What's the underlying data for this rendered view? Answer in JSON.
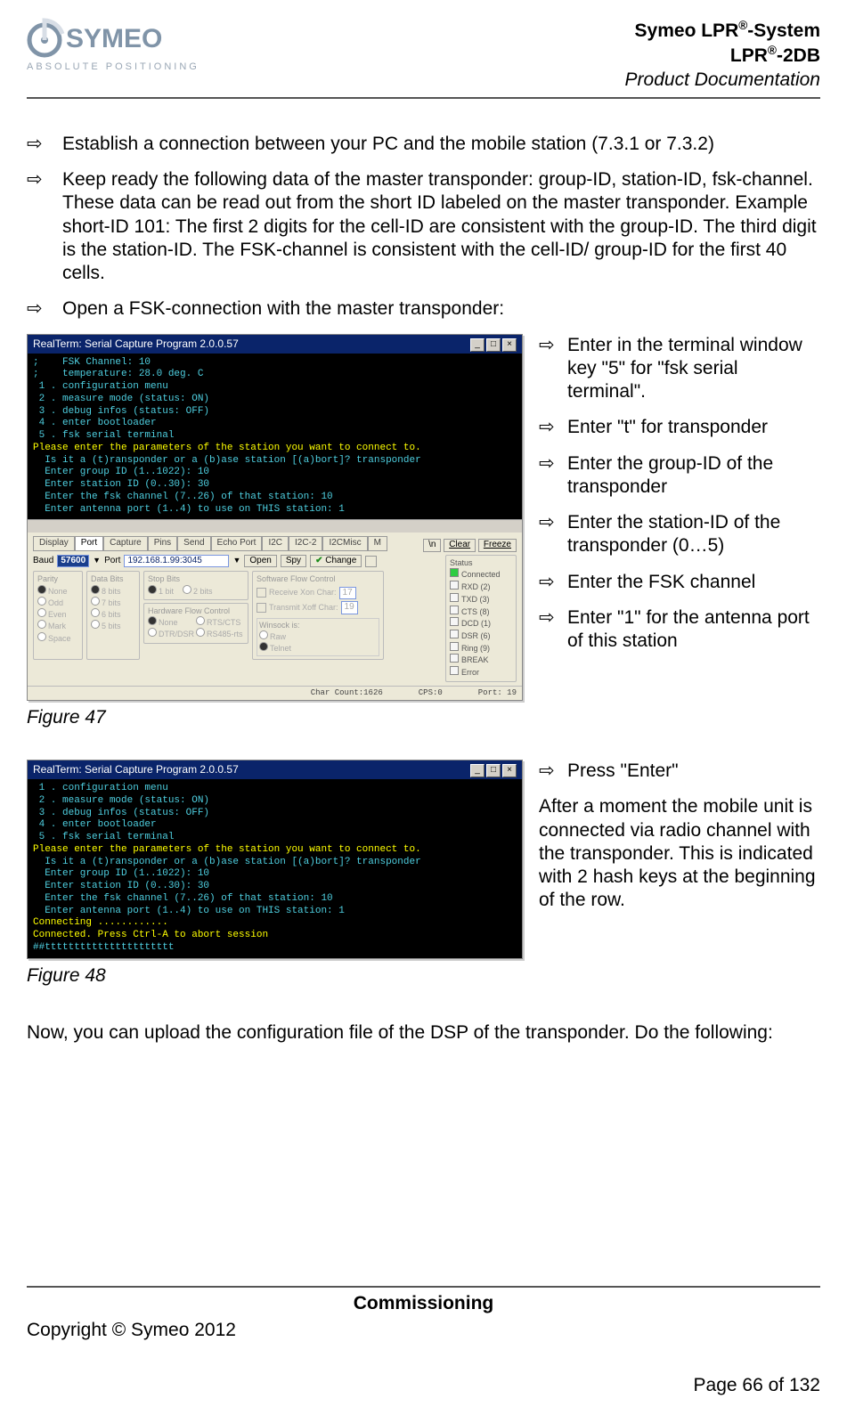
{
  "header": {
    "logo_top": "SYMEO",
    "logo_bottom": "ABSOLUTE POSITIONING",
    "line1a": "Symeo LPR",
    "line1b": "-System",
    "line2a": "LPR",
    "line2b": "-2DB",
    "line3": "Product Documentation",
    "reg": "®"
  },
  "content": {
    "arrow": "⇨",
    "b1": "Establish a connection between your PC and the mobile station (7.3.1 or 7.3.2)",
    "b2": "Keep ready the following data of the master transponder: group-ID, station-ID, fsk-channel. These data can be read out from the short ID labeled on the master transponder. Example short-ID 101: The first 2 digits for the cell-ID are consistent with the group-ID. The third digit is the station-ID. The FSK-channel is consistent with the cell-ID/ group-ID for the first 40 cells.",
    "b3": "Open a FSK-connection with the master transponder:",
    "side1": [
      "Enter in the terminal window key \"5\" for \"fsk serial terminal\".",
      "Enter \"t\" for transponder",
      "Enter the group-ID of the transponder",
      "Enter the station-ID of the transponder (0…5)",
      "Enter the FSK channel",
      "Enter \"1\" for the antenna port of this station"
    ],
    "fig47_caption": "Figure 47",
    "side2_bullet": "Press \"Enter\"",
    "side2_para": "After a moment the mobile unit is connected via radio channel with the transponder. This is indicated with 2 hash keys at the beginning of the row.",
    "fig48_caption": "Figure 48",
    "final_para": "Now, you can upload the configuration file of the DSP of the transponder. Do the following:"
  },
  "shot1": {
    "title": "RealTerm: Serial Capture Program 2.0.0.57",
    "term_lines": [
      {
        "c": "cyan",
        "t": ";    FSK Channel: 10"
      },
      {
        "c": "cyan",
        "t": ";    temperature: 28.0 deg. C"
      },
      {
        "c": "cyan",
        "t": ""
      },
      {
        "c": "cyan",
        "t": " 1 . configuration menu"
      },
      {
        "c": "cyan",
        "t": " 2 . measure mode (status: ON)"
      },
      {
        "c": "cyan",
        "t": " 3 . debug infos (status: OFF)"
      },
      {
        "c": "cyan",
        "t": " 4 . enter bootloader"
      },
      {
        "c": "cyan",
        "t": " 5 . fsk serial terminal"
      },
      {
        "c": "cyan",
        "t": ""
      },
      {
        "c": "y",
        "t": "Please enter the parameters of the station you want to connect to."
      },
      {
        "c": "cyan",
        "t": "  Is it a (t)ransponder or a (b)ase station [(a)bort]? transponder"
      },
      {
        "c": "cyan",
        "t": "  Enter group ID (1..1022): 10"
      },
      {
        "c": "cyan",
        "t": "  Enter station ID (0..30): 30"
      },
      {
        "c": "cyan",
        "t": "  Enter the fsk channel (7..26) of that station: 10"
      },
      {
        "c": "cyan",
        "t": "  Enter antenna port (1..4) to use on THIS station: 1"
      }
    ],
    "tabs": [
      "Display",
      "Port",
      "Capture",
      "Pins",
      "Send",
      "Echo Port",
      "I2C",
      "I2C-2",
      "I2CMisc",
      "M"
    ],
    "active_tab_index": 1,
    "side_btns": {
      "n": "\\n",
      "clear": "Clear",
      "freeze": "Freeze"
    },
    "baud_label": "Baud",
    "baud_value": "57600",
    "port_label": "Port",
    "port_value": "192.168.1.99:3045",
    "open": "Open",
    "spy": "Spy",
    "change": "Change",
    "panels": {
      "parity": {
        "title": "Parity",
        "items": [
          "None",
          "Odd",
          "Even",
          "Mark",
          "Space"
        ]
      },
      "databits": {
        "title": "Data Bits",
        "items": [
          "8 bits",
          "7 bits",
          "6 bits",
          "5 bits"
        ]
      },
      "stopbits": {
        "title": "Stop Bits",
        "items": [
          "1 bit",
          "2 bits"
        ]
      },
      "hwflow": {
        "title": "Hardware Flow Control",
        "items": [
          "None",
          "RTS/CTS",
          "DTR/DSR",
          "RS485-rts"
        ]
      },
      "swflow": {
        "title": "Software Flow Control",
        "rx": "Receive  Xon Char:",
        "tx": "Transmit  Xoff Char:",
        "rxv": "17",
        "txv": "19"
      },
      "winsock": {
        "title": "Winsock is:",
        "items": [
          "Raw",
          "Telnet"
        ]
      }
    },
    "status": {
      "title": "Status",
      "items": [
        "Connected",
        "RXD (2)",
        "TXD (3)",
        "CTS (8)",
        "DCD (1)",
        "DSR (6)",
        "Ring (9)",
        "BREAK",
        "Error"
      ]
    },
    "statusbar": {
      "a": "Char Count:1626",
      "b": "CPS:0",
      "c": "Port: 19"
    }
  },
  "shot2": {
    "title": "RealTerm: Serial Capture Program 2.0.0.57",
    "term_lines": [
      {
        "c": "cyan",
        "t": " 1 . configuration menu"
      },
      {
        "c": "cyan",
        "t": " 2 . measure mode (status: ON)"
      },
      {
        "c": "cyan",
        "t": " 3 . debug infos (status: OFF)      "
      },
      {
        "c": "cyan",
        "t": " 4 . enter bootloader"
      },
      {
        "c": "cyan",
        "t": " 5 . fsk serial terminal"
      },
      {
        "c": "cyan",
        "t": ""
      },
      {
        "c": "y",
        "t": "Please enter the parameters of the station you want to connect to."
      },
      {
        "c": "cyan",
        "t": "  Is it a (t)ransponder or a (b)ase station [(a)bort]? transponder"
      },
      {
        "c": "cyan",
        "t": "  Enter group ID (1..1022): 10"
      },
      {
        "c": "cyan",
        "t": "  Enter station ID (0..30): 30"
      },
      {
        "c": "cyan",
        "t": "  Enter the fsk channel (7..26) of that station: 10"
      },
      {
        "c": "cyan",
        "t": "  Enter antenna port (1..4) to use on THIS station: 1"
      },
      {
        "c": "y",
        "t": "Connecting ............"
      },
      {
        "c": "y",
        "t": "Connected. Press Ctrl-A to abort session"
      },
      {
        "c": "cyan",
        "t": "##tttttttttttttttttttttt"
      }
    ]
  },
  "footer": {
    "center": "Commissioning",
    "left": "Copyright © Symeo 2012",
    "right": "Page 66 of 132"
  }
}
